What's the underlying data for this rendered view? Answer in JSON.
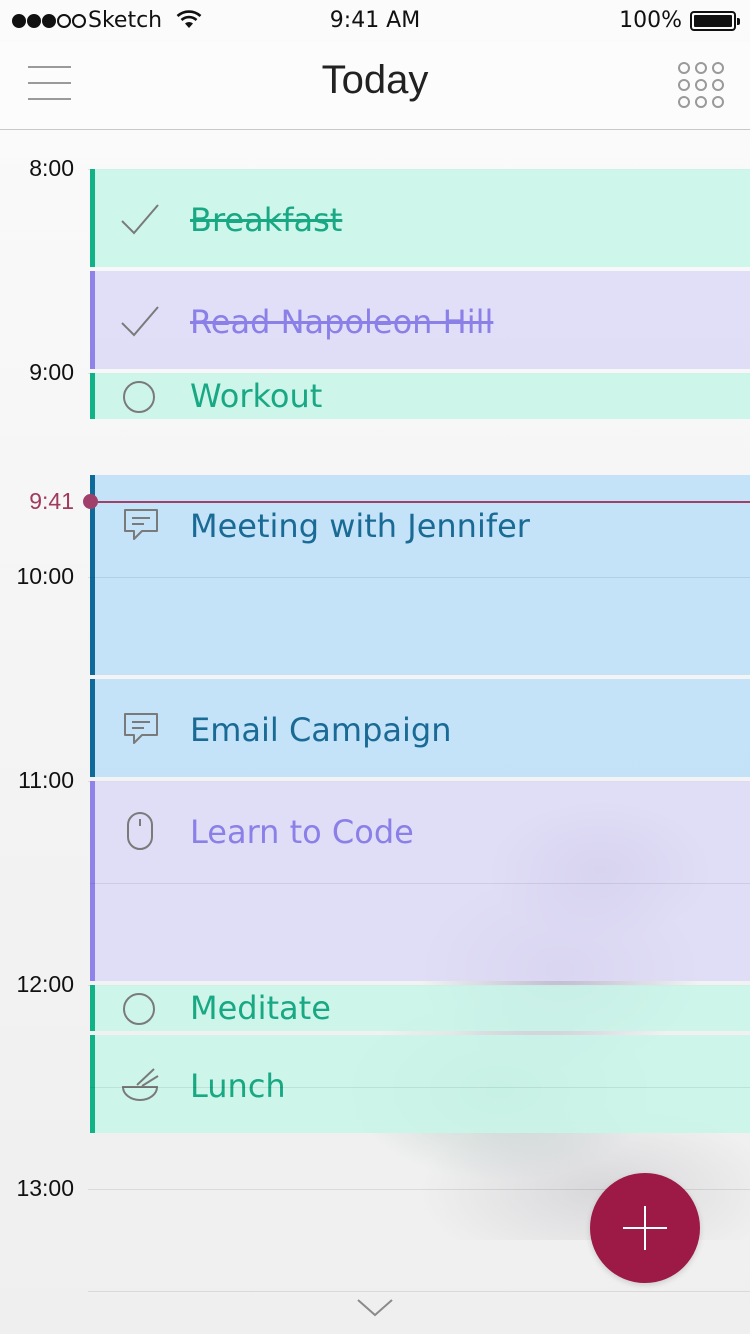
{
  "status_bar": {
    "carrier": "Sketch",
    "time": "9:41 AM",
    "battery": "100%",
    "signal_bars_filled": 3,
    "signal_bars_total": 5
  },
  "nav": {
    "title": "Today",
    "left_icon": "hamburger-menu-icon",
    "right_icon": "grid-dots-icon"
  },
  "timeline": {
    "hours": [
      "8:00",
      "9:00",
      "10:00",
      "11:00",
      "12:00",
      "13:00"
    ],
    "now": "9:41"
  },
  "events": [
    {
      "title": "Breakfast",
      "color": "green",
      "icon": "checkmark-icon",
      "done": true
    },
    {
      "title": "Read Napoleon Hill",
      "color": "purple",
      "icon": "checkmark-icon",
      "done": true
    },
    {
      "title": "Workout",
      "color": "green",
      "icon": "circle-icon",
      "done": false
    },
    {
      "title": "Meeting with Jennifer",
      "color": "blue",
      "icon": "chat-bubble-icon",
      "done": false
    },
    {
      "title": "Email Campaign",
      "color": "blue",
      "icon": "chat-bubble-icon",
      "done": false
    },
    {
      "title": "Learn to Code",
      "color": "purple",
      "icon": "mouse-icon",
      "done": false
    },
    {
      "title": "Meditate",
      "color": "green",
      "icon": "circle-icon",
      "done": false
    },
    {
      "title": "Lunch",
      "color": "green",
      "icon": "bowl-icon",
      "done": false
    }
  ],
  "colors": {
    "green": "#12b287",
    "purple": "#8f83ea",
    "blue": "#0f6a99",
    "accent": "#9c1a45",
    "now": "#a0406a"
  },
  "fab_icon": "plus-icon",
  "scroll_icon": "chevron-down-icon"
}
